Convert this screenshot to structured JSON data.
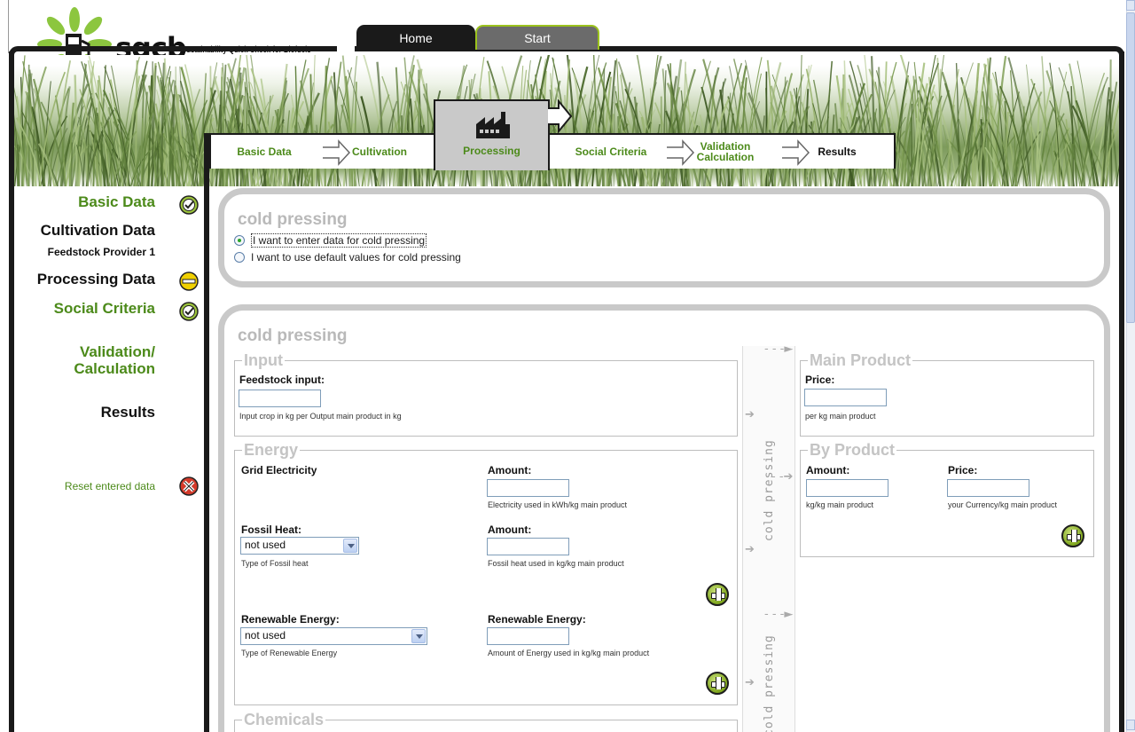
{
  "app": {
    "brand": "sqcb",
    "tagline": "Sustainability Quick Check for Biofuels"
  },
  "top_nav": {
    "home": "Home",
    "start": "Start"
  },
  "steps": {
    "basic": "Basic Data",
    "cultivation": "Cultivation",
    "processing": "Processing",
    "social": "Social Criteria",
    "validation": "Validation Calculation",
    "results": "Results"
  },
  "sidebar": {
    "basic_data": "Basic Data",
    "cultivation_data": "Cultivation Data",
    "feedstock_provider": "Feedstock Provider 1",
    "processing_data": "Processing Data",
    "social_criteria": "Social Criteria",
    "validation": "Validation/ Calculation",
    "results": "Results",
    "reset": "Reset entered data",
    "icons": {
      "basic_data": "check-icon",
      "processing_data": "in-progress-icon",
      "social_criteria": "check-icon",
      "reset": "reset-icon"
    }
  },
  "choice_panel": {
    "title": "cold pressing",
    "option_enter": "I want to enter data for cold pressing",
    "option_default": "I want to use default values for cold pressing",
    "selected": "option_enter"
  },
  "form": {
    "title": "cold pressing",
    "flow_label": "cold pressing",
    "input": {
      "legend": "Input",
      "feedstock_label": "Feedstock input:",
      "feedstock_value": "",
      "feedstock_hint": "Input crop in kg per Output main product in kg"
    },
    "energy": {
      "legend": "Energy",
      "grid_label": "Grid Electricity",
      "grid_amount_label": "Amount:",
      "grid_amount_value": "",
      "grid_amount_hint": "Electricity used in kWh/kg main product",
      "fossil_label": "Fossil Heat:",
      "fossil_selected": "not used",
      "fossil_hint": "Type of Fossil heat",
      "fossil_amount_label": "Amount:",
      "fossil_amount_value": "",
      "fossil_amount_hint": "Fossil heat used in kg/kg main product",
      "renewable_label": "Renewable Energy:",
      "renewable_selected": "not used",
      "renewable_hint": "Type of Renewable Energy",
      "renewable_amount_label": "Renewable Energy:",
      "renewable_amount_value": "",
      "renewable_amount_hint": "Amount of Energy used in kg/kg main product"
    },
    "chemicals": {
      "legend": "Chemicals"
    },
    "main_product": {
      "legend": "Main Product",
      "price_label": "Price:",
      "price_value": "",
      "price_hint": "per kg main product"
    },
    "by_product": {
      "legend": "By Product",
      "amount_label": "Amount:",
      "amount_value": "",
      "amount_hint": "kg/kg main product",
      "price_label": "Price:",
      "price_value": "",
      "price_hint": "your Currency/kg main product"
    }
  },
  "colors": {
    "accent_green": "#4c8a1a",
    "frame": "#1a1a1a",
    "panel_border": "#c9c9c9"
  }
}
